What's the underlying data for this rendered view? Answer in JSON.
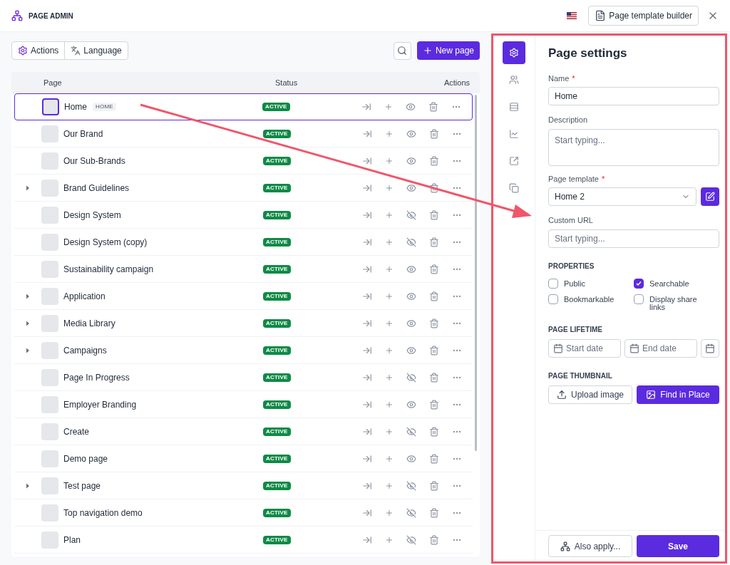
{
  "header": {
    "title": "PAGE ADMIN",
    "builder_button": "Page template builder"
  },
  "toolbar": {
    "actions": "Actions",
    "language": "Language",
    "new_page": "New page"
  },
  "table": {
    "columns": [
      "Page",
      "Status",
      "Actions"
    ],
    "rows": [
      {
        "name": "Home",
        "tag": "HOME",
        "status": "ACTIVE",
        "visible": true,
        "expandable": false,
        "selected": true
      },
      {
        "name": "Our Brand",
        "status": "ACTIVE",
        "visible": true,
        "expandable": false,
        "selected": false
      },
      {
        "name": "Our Sub-Brands",
        "status": "ACTIVE",
        "visible": true,
        "expandable": false,
        "selected": false
      },
      {
        "name": "Brand Guidelines",
        "status": "ACTIVE",
        "visible": true,
        "expandable": true,
        "selected": false
      },
      {
        "name": "Design System",
        "status": "ACTIVE",
        "visible": false,
        "expandable": false,
        "selected": false
      },
      {
        "name": "Design System (copy)",
        "status": "ACTIVE",
        "visible": false,
        "expandable": false,
        "selected": false
      },
      {
        "name": "Sustainability campaign",
        "status": "ACTIVE",
        "visible": true,
        "expandable": false,
        "selected": false
      },
      {
        "name": "Application",
        "status": "ACTIVE",
        "visible": true,
        "expandable": true,
        "selected": false
      },
      {
        "name": "Media Library",
        "status": "ACTIVE",
        "visible": true,
        "expandable": true,
        "selected": false
      },
      {
        "name": "Campaigns",
        "status": "ACTIVE",
        "visible": true,
        "expandable": true,
        "selected": false
      },
      {
        "name": "Page In Progress",
        "status": "ACTIVE",
        "visible": false,
        "expandable": false,
        "selected": false
      },
      {
        "name": "Employer Branding",
        "status": "ACTIVE",
        "visible": true,
        "expandable": false,
        "selected": false
      },
      {
        "name": "Create",
        "status": "ACTIVE",
        "visible": false,
        "expandable": false,
        "selected": false
      },
      {
        "name": "Demo page",
        "status": "ACTIVE",
        "visible": true,
        "expandable": false,
        "selected": false
      },
      {
        "name": "Test page",
        "status": "ACTIVE",
        "visible": false,
        "expandable": true,
        "selected": false
      },
      {
        "name": "Top navigation demo",
        "status": "ACTIVE",
        "visible": false,
        "expandable": false,
        "selected": false
      },
      {
        "name": "Plan",
        "status": "ACTIVE",
        "visible": false,
        "expandable": false,
        "selected": false
      }
    ]
  },
  "side_nav": [
    {
      "selected": true
    },
    {
      "selected": false
    },
    {
      "selected": false
    },
    {
      "selected": false
    },
    {
      "selected": false
    },
    {
      "selected": false
    }
  ],
  "settings": {
    "title": "Page settings",
    "name": {
      "label": "Name",
      "required_mark": "*",
      "value": "Home"
    },
    "description": {
      "label": "Description",
      "placeholder": "Start typing..."
    },
    "template": {
      "label": "Page template",
      "required_mark": "*",
      "value": "Home 2"
    },
    "custom_url": {
      "label": "Custom URL",
      "placeholder": "Start typing..."
    },
    "properties_heading": "PROPERTIES",
    "properties": [
      {
        "label": "Public",
        "checked": false
      },
      {
        "label": "Searchable",
        "checked": true
      },
      {
        "label": "Bookmarkable",
        "checked": false
      },
      {
        "label": "Display share links",
        "checked": false
      }
    ],
    "lifetime_heading": "PAGE LIFETIME",
    "start_date": {
      "placeholder": "Start date"
    },
    "end_date": {
      "placeholder": "End date"
    },
    "thumbnail_heading": "PAGE THUMBNAIL",
    "upload": "Upload image",
    "find": "Find in Place",
    "also_apply": "Also apply...",
    "save": "Save"
  }
}
